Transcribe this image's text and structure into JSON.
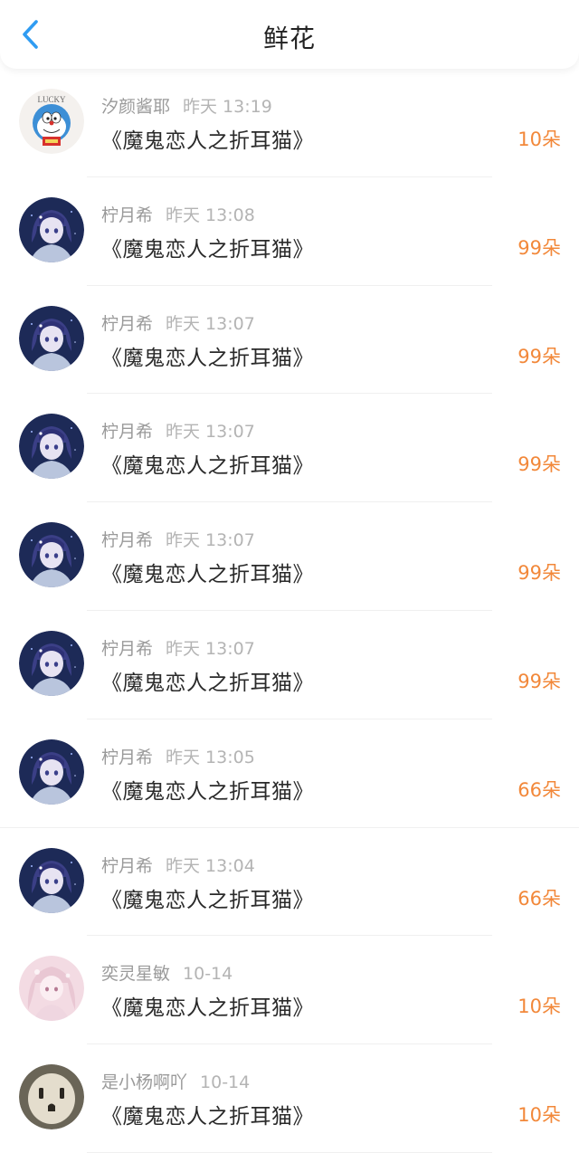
{
  "header": {
    "title": "鲜花"
  },
  "entries": [
    {
      "user": "汐颜酱耶",
      "time": "昨天 13:19",
      "gift": "《魔鬼恋人之折耳猫》",
      "count": "10朵",
      "avatar": "doraemon-lucky-icon",
      "avatar_text": "LUCKY"
    },
    {
      "user": "柠月希",
      "time": "昨天 13:08",
      "gift": "《魔鬼恋人之折耳猫》",
      "count": "99朵",
      "avatar": "anime-girl-blue-icon"
    },
    {
      "user": "柠月希",
      "time": "昨天 13:07",
      "gift": "《魔鬼恋人之折耳猫》",
      "count": "99朵",
      "avatar": "anime-girl-blue-icon"
    },
    {
      "user": "柠月希",
      "time": "昨天 13:07",
      "gift": "《魔鬼恋人之折耳猫》",
      "count": "99朵",
      "avatar": "anime-girl-blue-icon"
    },
    {
      "user": "柠月希",
      "time": "昨天 13:07",
      "gift": "《魔鬼恋人之折耳猫》",
      "count": "99朵",
      "avatar": "anime-girl-blue-icon"
    },
    {
      "user": "柠月希",
      "time": "昨天 13:07",
      "gift": "《魔鬼恋人之折耳猫》",
      "count": "99朵",
      "avatar": "anime-girl-blue-icon"
    },
    {
      "user": "柠月希",
      "time": "昨天 13:05",
      "gift": "《魔鬼恋人之折耳猫》",
      "count": "66朵",
      "avatar": "anime-girl-blue-icon"
    },
    {
      "user": "柠月希",
      "time": "昨天 13:04",
      "gift": "《魔鬼恋人之折耳猫》",
      "count": "66朵",
      "avatar": "anime-girl-blue-icon"
    },
    {
      "user": "奕灵星敏",
      "time": "10-14",
      "gift": "《魔鬼恋人之折耳猫》",
      "count": "10朵",
      "avatar": "anime-girl-pink-icon"
    },
    {
      "user": "是小杨啊吖",
      "time": "10-14",
      "gift": "《魔鬼恋人之折耳猫》",
      "count": "10朵",
      "avatar": "power-outlet-icon"
    }
  ],
  "colors": {
    "accent": "#f2883a",
    "back_arrow": "#2f9cf2",
    "title": "#222222",
    "meta": "#9a9a9a"
  }
}
